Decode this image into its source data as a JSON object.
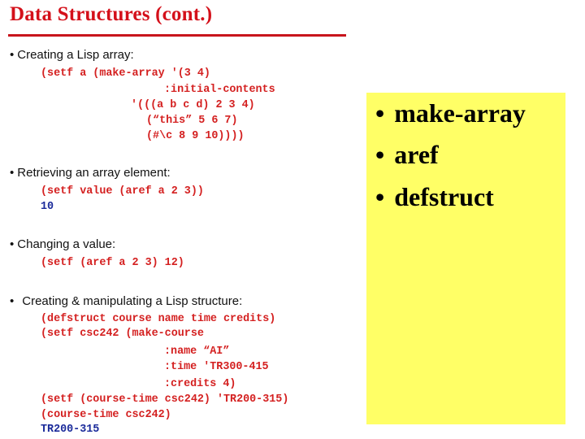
{
  "slide": {
    "title": "Data Structures (cont.)",
    "colors": {
      "title": "#d4101a",
      "rule": "#c8141c",
      "code": "#d42020",
      "result": "#1a2a9a",
      "highlight_box": "#ffff66"
    }
  },
  "sections": [
    {
      "bullet": "Creating a Lisp array:",
      "code": [
        "(setf a (make-array '(3 4)",
        ":initial-contents",
        "'(((a b c d) 2 3 4)",
        "(“this” 5 6 7)",
        "(#\\c 8 9 10))))"
      ]
    },
    {
      "bullet": "Retrieving an array element:",
      "code": [
        "(setf value (aref a 2 3))"
      ],
      "result": "10"
    },
    {
      "bullet": "Changing a value:",
      "code": [
        "(setf (aref a 2 3) 12)"
      ]
    },
    {
      "bullet": "Creating & manipulating a Lisp structure:",
      "code": [
        "(defstruct course name time credits)",
        "(setf csc242 (make-course",
        ":name “AI”",
        ":time 'TR300-415",
        ":credits 4)",
        "(setf (course-time csc242) 'TR200-315)",
        "(course-time csc242)"
      ],
      "result": "TR200-315"
    }
  ],
  "bullet_glyph": "•",
  "highlight": {
    "items": [
      "make-array",
      "aref",
      "defstruct"
    ]
  }
}
